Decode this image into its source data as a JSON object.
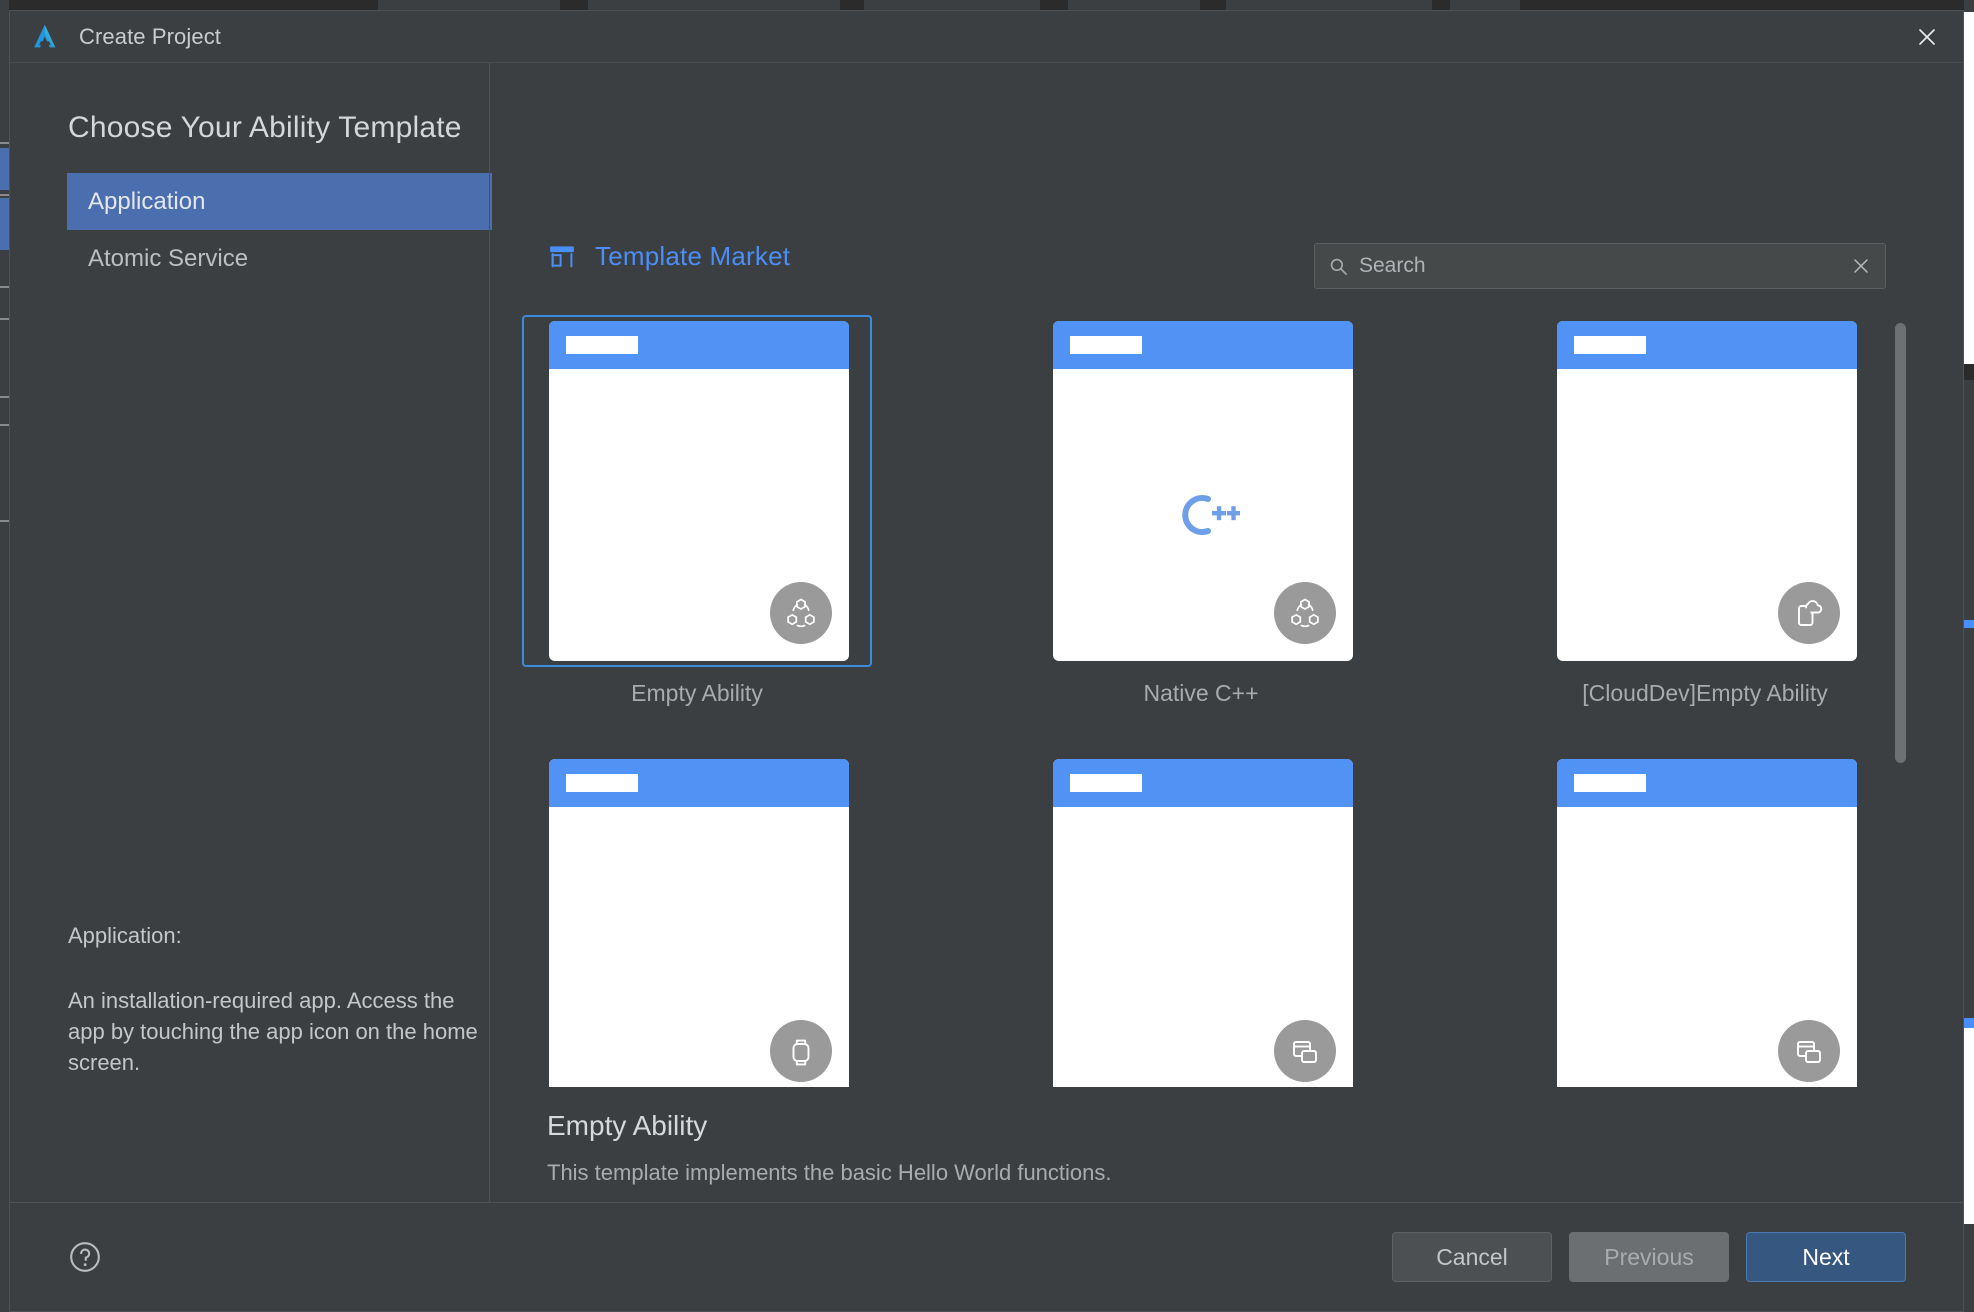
{
  "window": {
    "title": "Create Project",
    "logo_icon": "appgallery-logo-icon",
    "close_icon": "close-icon"
  },
  "page": {
    "heading": "Choose Your Ability Template"
  },
  "sidebar": {
    "items": [
      {
        "label": "Application",
        "selected": true
      },
      {
        "label": "Atomic Service",
        "selected": false
      }
    ],
    "info": {
      "title": "Application:",
      "description": "An installation-required app. Access the app by touching the app icon on the home screen."
    }
  },
  "market": {
    "icon": "storefront-icon",
    "label": "Template Market"
  },
  "search": {
    "icon": "search-icon",
    "placeholder": "Search",
    "value": "",
    "clear_icon": "close-x-icon"
  },
  "templates": [
    {
      "label": "Empty Ability",
      "badge_icon": "ability-hexagons-icon",
      "selected": true,
      "center_mark": null,
      "row": 1
    },
    {
      "label": "Native C++",
      "badge_icon": "ability-hexagons-icon",
      "selected": false,
      "center_mark": "C++",
      "row": 1
    },
    {
      "label": "[CloudDev]Empty Ability",
      "badge_icon": "phone-cloud-icon",
      "selected": false,
      "center_mark": null,
      "row": 1
    },
    {
      "label": "",
      "badge_icon": "wearable-icon",
      "selected": false,
      "center_mark": null,
      "row": 2
    },
    {
      "label": "",
      "badge_icon": "tablet-split-icon",
      "selected": false,
      "center_mark": null,
      "row": 2
    },
    {
      "label": "",
      "badge_icon": "tablet-split-icon",
      "selected": false,
      "center_mark": null,
      "row": 2
    }
  ],
  "detail": {
    "title": "Empty Ability",
    "description": "This template implements the basic Hello World functions."
  },
  "footer": {
    "help_icon": "help-circle-icon",
    "cancel_label": "Cancel",
    "previous_label": "Previous",
    "next_label": "Next"
  },
  "colors": {
    "dialog_bg": "#3c3f41",
    "accent_blue": "#4a8ef7",
    "selection_blue": "#4b6eaf",
    "thumb_bar_blue": "#5193f5",
    "next_button": "#365880",
    "selected_card_border": "#3d8bdd"
  },
  "scrollbar": {
    "thumb_top_pct": 0,
    "thumb_height_pct": 63
  }
}
